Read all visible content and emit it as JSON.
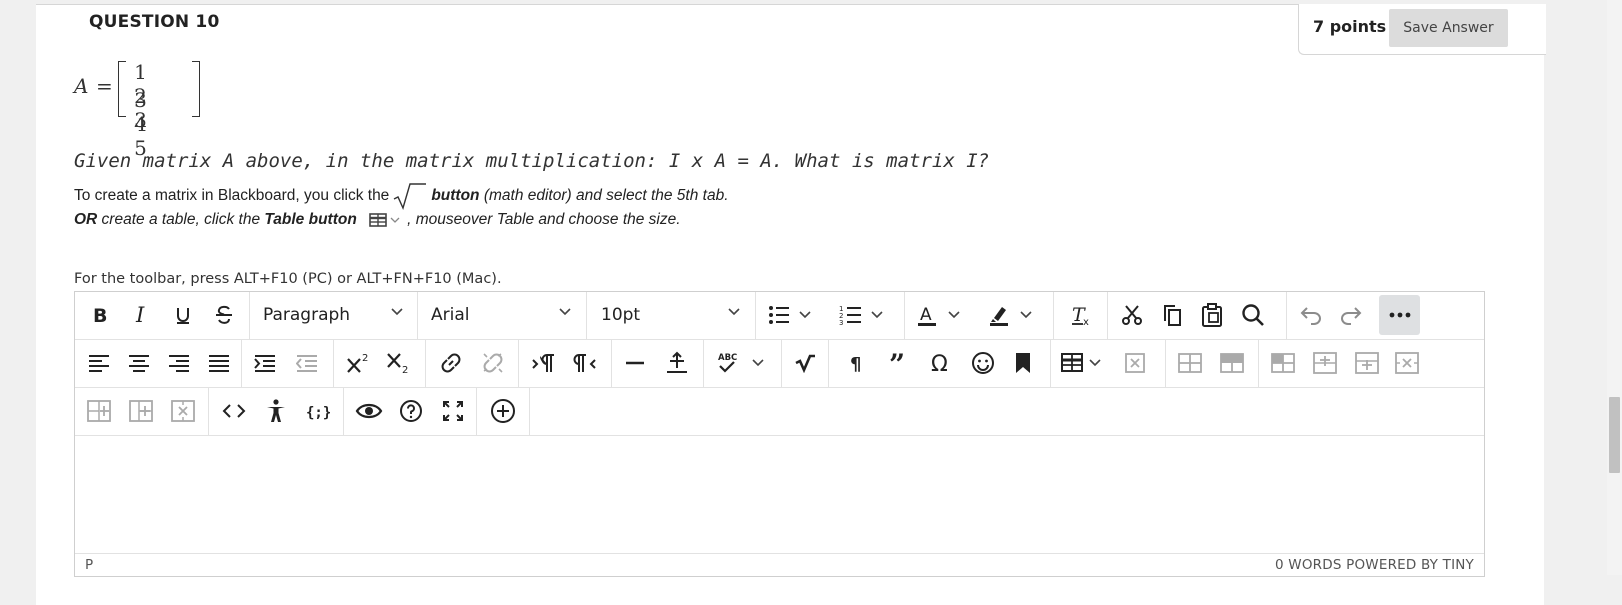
{
  "question": {
    "title": "QUESTION 10",
    "points": "7 points",
    "save_label": "Save Answer",
    "matrix": {
      "name": "A",
      "equals": "=",
      "rows": [
        [
          "1",
          "2",
          "3"
        ],
        [
          "3",
          "4",
          "5"
        ]
      ]
    },
    "prompt": "Given matrix A above, in the matrix multiplication: I x A = A. What is matrix I?",
    "instruction1": {
      "part1": "To create a matrix in Blackboard, you click the",
      "bold": "button",
      "part2": " (math editor) and select the 5th tab."
    },
    "instruction2": {
      "bold1": "OR",
      "part1": " create a table, click the ",
      "bold2": "Table button",
      "part2": ", mouseover Table and choose the size."
    }
  },
  "editor": {
    "toolbar_hint": "For the toolbar, press ALT+F10 (PC) or ALT+FN+F10 (Mac).",
    "format_block": "Paragraph",
    "font_family": "Arial",
    "font_size": "10pt",
    "status_path": "P",
    "status_words": "0 WORDS  POWERED BY TINY",
    "body_text": ""
  },
  "colors": {
    "page_bg": "#f0f0f0",
    "save_button_bg": "#dcdcdc",
    "more_button_bg": "#dee0e2",
    "disabled_icon": "#b0b0b0"
  },
  "icons": {
    "row1": [
      "bold-icon",
      "italic-icon",
      "underline-icon",
      "strikethrough-icon",
      "bullet-list-icon",
      "numbered-list-icon",
      "text-color-icon",
      "highlight-icon",
      "clear-formatting-icon",
      "cut-icon",
      "copy-icon",
      "paste-icon",
      "find-icon",
      "undo-icon",
      "redo-icon",
      "more-icon"
    ],
    "row2": [
      "align-left-icon",
      "align-center-icon",
      "align-right-icon",
      "justify-icon",
      "indent-icon",
      "outdent-icon",
      "superscript-icon",
      "subscript-icon",
      "link-icon",
      "unlink-icon",
      "ltr-icon",
      "rtl-icon",
      "horizontal-line-icon",
      "plus-minus-icon",
      "spellcheck-icon",
      "math-icon",
      "pilcrow-icon",
      "blockquote-icon",
      "omega-icon",
      "emoticon-icon",
      "bookmark-icon",
      "table-icon",
      "table-delete-icon",
      "table-row-above-icon",
      "table-row-below-icon",
      "table-col-icons"
    ],
    "row3": [
      "table-insert-col-icon",
      "table-insert-col-after-icon",
      "table-delete-col-icon",
      "code-icon",
      "accessibility-icon",
      "html-code-icon",
      "preview-icon",
      "help-icon",
      "fullscreen-icon",
      "add-content-icon"
    ]
  }
}
